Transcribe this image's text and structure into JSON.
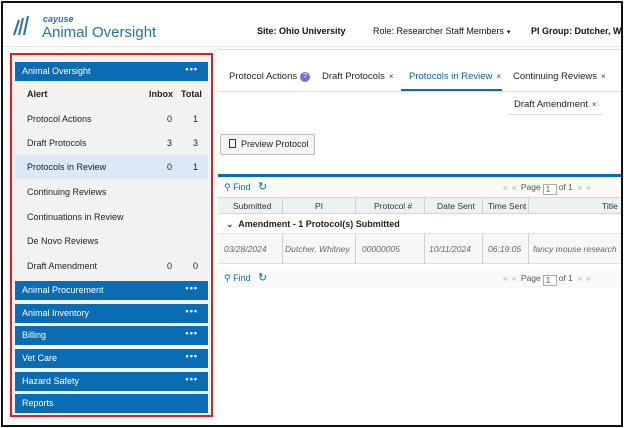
{
  "header": {
    "brand_small": "cayuse",
    "brand_main": "Animal Oversight",
    "site": "Site: Ohio University",
    "role": "Role: Researcher Staff Members",
    "pi_group": "PI Group: Dutcher, Wh",
    "caret_glyph": "▾"
  },
  "sidebar": {
    "oversight_title": "Animal Oversight",
    "menu_dots": "•••",
    "columns": {
      "alert": "Alert",
      "inbox": "Inbox",
      "total": "Total"
    },
    "items": [
      {
        "label": "Protocol Actions",
        "inbox": "0",
        "total": "1"
      },
      {
        "label": "Draft Protocols",
        "inbox": "3",
        "total": "3"
      },
      {
        "label": "Protocols in Review",
        "inbox": "0",
        "total": "1"
      },
      {
        "label": "Continuing Reviews",
        "inbox": "",
        "total": ""
      },
      {
        "label": "Continuations in Review",
        "inbox": "",
        "total": ""
      },
      {
        "label": "De Novo Reviews",
        "inbox": "",
        "total": ""
      },
      {
        "label": "Draft Amendment",
        "inbox": "0",
        "total": "0"
      }
    ],
    "sections": [
      {
        "label": "Animal Procurement"
      },
      {
        "label": "Animal Inventory"
      },
      {
        "label": "Billing"
      },
      {
        "label": "Vet Care"
      },
      {
        "label": "Hazard Safety"
      },
      {
        "label": "Reports"
      }
    ]
  },
  "tabs": {
    "protocol_actions": "Protocol Actions",
    "help_glyph": "?",
    "draft_protocols": "Draft Protocols",
    "protocols_in_review": "Protocols in Review",
    "continuing_reviews": "Continuing Reviews",
    "draft_amendment": "Draft Amendment",
    "close_glyph": "×"
  },
  "toolbar": {
    "preview_protocol": "Preview Protocol"
  },
  "grid": {
    "find": "Find",
    "refresh_glyph": "↻",
    "pager": {
      "first": "«",
      "prev": "«",
      "page_label": "Page",
      "page_value": "1",
      "of_label": "of 1",
      "next": "»",
      "last": "»"
    },
    "columns": {
      "submitted": "Submitted",
      "pi": "PI",
      "protocol_num": "Protocol #",
      "date_sent": "Date Sent",
      "time_sent": "Time Sent",
      "title": "Title"
    },
    "group_toggle": "⌄",
    "group_label": "Amendment - 1 Protocol(s) Submitted",
    "rows": [
      {
        "submitted": "03/28/2024",
        "pi": "Dutcher, Whitney",
        "protocol_num": "00000005",
        "date_sent": "10/11/2024",
        "time_sent": "06:19:05",
        "title": "fancy mouse research"
      }
    ]
  }
}
